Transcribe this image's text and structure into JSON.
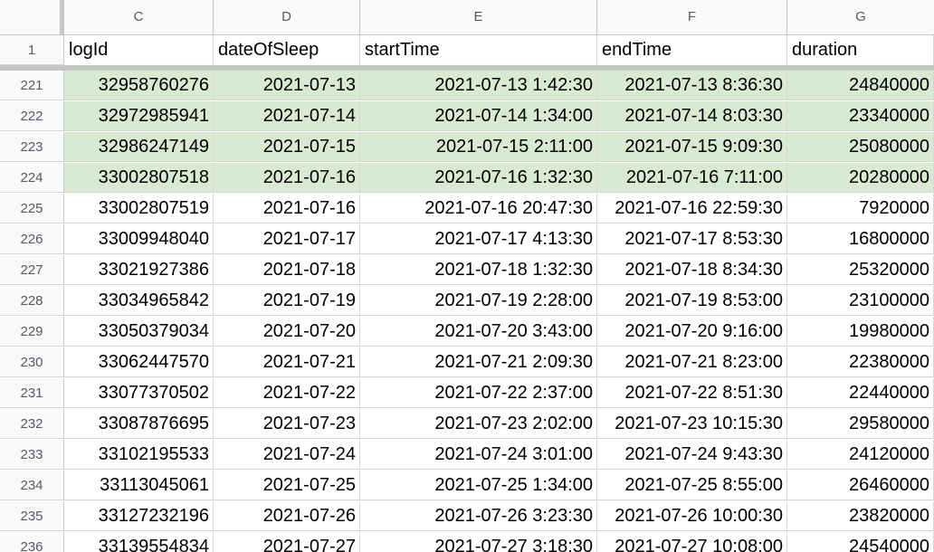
{
  "sheet": {
    "corner_label": "",
    "columns": [
      "C",
      "D",
      "E",
      "F",
      "G"
    ],
    "header_row": {
      "num": "1",
      "cells": [
        "logId",
        "dateOfSleep",
        "startTime",
        "endTime",
        "duration"
      ]
    },
    "highlight_color": "#d9ead3",
    "rows": [
      {
        "num": "221",
        "highlighted": true,
        "cells": [
          "32958760276",
          "2021-07-13",
          "2021-07-13 1:42:30",
          "2021-07-13 8:36:30",
          "24840000"
        ]
      },
      {
        "num": "222",
        "highlighted": true,
        "cells": [
          "32972985941",
          "2021-07-14",
          "2021-07-14 1:34:00",
          "2021-07-14 8:03:30",
          "23340000"
        ]
      },
      {
        "num": "223",
        "highlighted": true,
        "cells": [
          "32986247149",
          "2021-07-15",
          "2021-07-15 2:11:00",
          "2021-07-15 9:09:30",
          "25080000"
        ]
      },
      {
        "num": "224",
        "highlighted": true,
        "cells": [
          "33002807518",
          "2021-07-16",
          "2021-07-16 1:32:30",
          "2021-07-16 7:11:00",
          "20280000"
        ]
      },
      {
        "num": "225",
        "highlighted": false,
        "cells": [
          "33002807519",
          "2021-07-16",
          "2021-07-16 20:47:30",
          "2021-07-16 22:59:30",
          "7920000"
        ]
      },
      {
        "num": "226",
        "highlighted": false,
        "cells": [
          "33009948040",
          "2021-07-17",
          "2021-07-17 4:13:30",
          "2021-07-17 8:53:30",
          "16800000"
        ]
      },
      {
        "num": "227",
        "highlighted": false,
        "cells": [
          "33021927386",
          "2021-07-18",
          "2021-07-18 1:32:30",
          "2021-07-18 8:34:30",
          "25320000"
        ]
      },
      {
        "num": "228",
        "highlighted": false,
        "cells": [
          "33034965842",
          "2021-07-19",
          "2021-07-19 2:28:00",
          "2021-07-19 8:53:00",
          "23100000"
        ]
      },
      {
        "num": "229",
        "highlighted": false,
        "cells": [
          "33050379034",
          "2021-07-20",
          "2021-07-20 3:43:00",
          "2021-07-20 9:16:00",
          "19980000"
        ]
      },
      {
        "num": "230",
        "highlighted": false,
        "cells": [
          "33062447570",
          "2021-07-21",
          "2021-07-21 2:09:30",
          "2021-07-21 8:23:00",
          "22380000"
        ]
      },
      {
        "num": "231",
        "highlighted": false,
        "cells": [
          "33077370502",
          "2021-07-22",
          "2021-07-22 2:37:00",
          "2021-07-22 8:51:30",
          "22440000"
        ]
      },
      {
        "num": "232",
        "highlighted": false,
        "cells": [
          "33087876695",
          "2021-07-23",
          "2021-07-23 2:02:00",
          "2021-07-23 10:15:30",
          "29580000"
        ]
      },
      {
        "num": "233",
        "highlighted": false,
        "cells": [
          "33102195533",
          "2021-07-24",
          "2021-07-24 3:01:00",
          "2021-07-24 9:43:30",
          "24120000"
        ]
      },
      {
        "num": "234",
        "highlighted": false,
        "cells": [
          "33113045061",
          "2021-07-25",
          "2021-07-25 1:34:00",
          "2021-07-25 8:55:00",
          "26460000"
        ]
      },
      {
        "num": "235",
        "highlighted": false,
        "cells": [
          "33127232196",
          "2021-07-26",
          "2021-07-26 3:23:30",
          "2021-07-26 10:00:30",
          "23820000"
        ]
      },
      {
        "num": "236",
        "highlighted": false,
        "cells": [
          "33139554834",
          "2021-07-27",
          "2021-07-27 3:18:30",
          "2021-07-27 10:08:00",
          "24540000"
        ]
      }
    ]
  }
}
